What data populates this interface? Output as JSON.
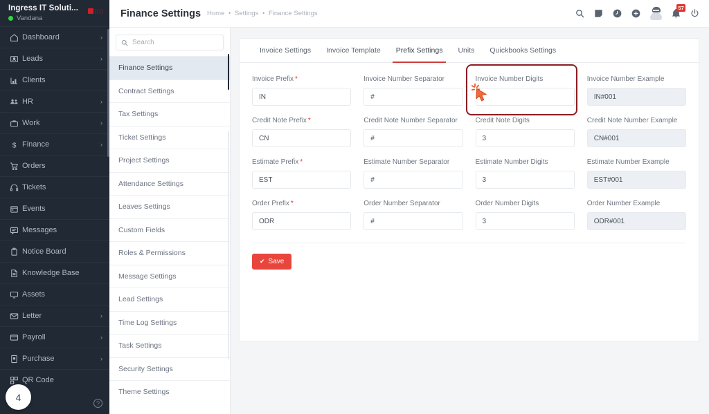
{
  "sidebar": {
    "brand": {
      "company": "Ingress IT Soluti...",
      "user": "Vandana"
    },
    "items": [
      {
        "label": "Dashboard",
        "icon": "home-icon",
        "caret": "›"
      },
      {
        "label": "Leads",
        "icon": "leads-icon",
        "caret": "›"
      },
      {
        "label": "Clients",
        "icon": "clients-icon",
        "caret": ""
      },
      {
        "label": "HR",
        "icon": "hr-icon",
        "caret": "›"
      },
      {
        "label": "Work",
        "icon": "work-icon",
        "caret": "›"
      },
      {
        "label": "Finance",
        "icon": "dollar-icon",
        "caret": "›"
      },
      {
        "label": "Orders",
        "icon": "cart-icon",
        "caret": ""
      },
      {
        "label": "Tickets",
        "icon": "headset-icon",
        "caret": ""
      },
      {
        "label": "Events",
        "icon": "calendar-icon",
        "caret": ""
      },
      {
        "label": "Messages",
        "icon": "message-icon",
        "caret": ""
      },
      {
        "label": "Notice Board",
        "icon": "clipboard-icon",
        "caret": ""
      },
      {
        "label": "Knowledge Base",
        "icon": "book-icon",
        "caret": ""
      },
      {
        "label": "Assets",
        "icon": "monitor-icon",
        "caret": ""
      },
      {
        "label": "Letter",
        "icon": "envelope-icon",
        "caret": "›"
      },
      {
        "label": "Payroll",
        "icon": "wallet-icon",
        "caret": "›"
      },
      {
        "label": "Purchase",
        "icon": "purchase-icon",
        "caret": "›"
      },
      {
        "label": "QR Code",
        "icon": "qr-icon",
        "caret": ""
      }
    ],
    "step_badge": "4",
    "help_icon_label": "?"
  },
  "topbar": {
    "title": "Finance Settings",
    "breadcrumb": [
      "Home",
      "Settings",
      "Finance Settings"
    ],
    "separator": "•",
    "icons": [
      "search-icon",
      "note-icon",
      "clock-icon",
      "plus-circle-icon",
      "avatar-icon",
      "bell-icon",
      "power-icon"
    ],
    "notification_count": "57"
  },
  "settings_nav": {
    "search_placeholder": "Search",
    "search_value": "",
    "items": [
      "Finance Settings",
      "Contract Settings",
      "Tax Settings",
      "Ticket Settings",
      "Project Settings",
      "Attendance Settings",
      "Leaves Settings",
      "Custom Fields",
      "Roles & Permissions",
      "Message Settings",
      "Lead Settings",
      "Time Log Settings",
      "Task Settings",
      "Security Settings",
      "Theme Settings"
    ],
    "active_index": 0
  },
  "panel": {
    "tabs": [
      "Invoice Settings",
      "Invoice Template",
      "Prefix Settings",
      "Units",
      "Quickbooks Settings"
    ],
    "active_tab_index": 2,
    "rows": [
      {
        "prefix": {
          "label": "Invoice Prefix",
          "required": "*",
          "value": "IN"
        },
        "separator": {
          "label": "Invoice Number Separator",
          "value": "#"
        },
        "digits": {
          "label": "Invoice Number Digits",
          "value": ""
        },
        "example": {
          "label": "Invoice Number Example",
          "value": "IN#001"
        }
      },
      {
        "prefix": {
          "label": "Credit Note Prefix",
          "required": "*",
          "value": "CN"
        },
        "separator": {
          "label": "Credit Note Number Separator",
          "value": "#"
        },
        "digits": {
          "label": "Credit Note Digits",
          "value": "3"
        },
        "example": {
          "label": "Credit Note Number Example",
          "value": "CN#001"
        }
      },
      {
        "prefix": {
          "label": "Estimate Prefix",
          "required": "*",
          "value": "EST"
        },
        "separator": {
          "label": "Estimate Number Separator",
          "value": "#"
        },
        "digits": {
          "label": "Estimate Number Digits",
          "value": "3"
        },
        "example": {
          "label": "Estimate Number Example",
          "value": "EST#001"
        }
      },
      {
        "prefix": {
          "label": "Order Prefix",
          "required": "*",
          "value": "ODR"
        },
        "separator": {
          "label": "Order Number Separator",
          "value": "#"
        },
        "digits": {
          "label": "Order Number Digits",
          "value": "3"
        },
        "example": {
          "label": "Order Number Example",
          "value": "ODR#001"
        }
      }
    ],
    "save_label": "Save",
    "save_check": "✔",
    "highlight_field": "Invoice Number Digits"
  },
  "colors": {
    "sidebar_bg": "#212934",
    "accent_red": "#e8453c",
    "tab_underline": "#cf3c3c",
    "highlight_border": "#8b1d22",
    "active_setting_bg": "#e3e9f0",
    "online_dot": "#2fd743"
  }
}
